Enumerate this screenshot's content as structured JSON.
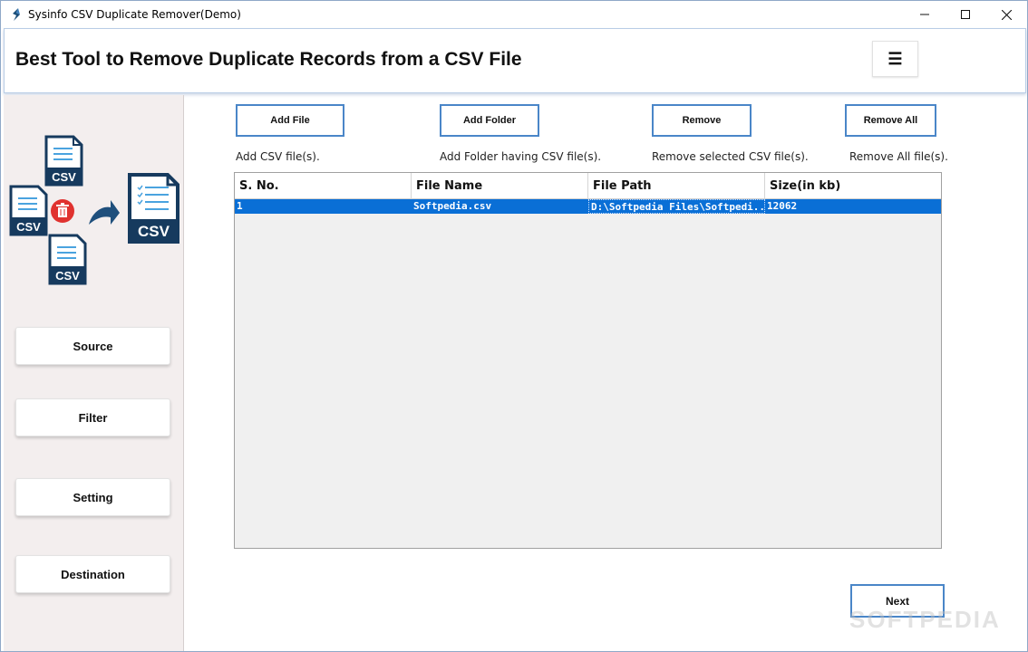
{
  "window": {
    "title": "Sysinfo CSV Duplicate Remover(Demo)"
  },
  "header": {
    "title": "Best Tool to Remove Duplicate Records from a CSV File",
    "menu_icon": "☰"
  },
  "hero": {
    "csv_label": "CSV",
    "icons": [
      "csv-file-icon",
      "delete-icon",
      "arrow-right-icon"
    ]
  },
  "sidebar": {
    "items": [
      {
        "label": "Source"
      },
      {
        "label": "Filter"
      },
      {
        "label": "Setting"
      },
      {
        "label": "Destination"
      }
    ]
  },
  "toolbar": {
    "add_file": {
      "label": "Add File",
      "hint": "Add CSV file(s)."
    },
    "add_folder": {
      "label": "Add Folder",
      "hint": "Add Folder having CSV file(s)."
    },
    "remove": {
      "label": "Remove",
      "hint": "Remove selected CSV file(s)."
    },
    "remove_all": {
      "label": "Remove All",
      "hint": "Remove All file(s)."
    }
  },
  "table": {
    "columns": [
      "S. No.",
      "File Name",
      "File Path",
      "Size(in kb)"
    ],
    "rows": [
      {
        "sno": "1",
        "name": "Softpedia.csv",
        "path": "D:\\Softpedia Files\\Softpedi...",
        "size": "12062"
      }
    ]
  },
  "footer": {
    "next_label": "Next"
  },
  "watermark": "SOFTPEDIA",
  "colors": {
    "accent": "#4a86c8",
    "selection": "#0a6fd6",
    "sidebar_bg": "#f3eeee",
    "doc_navy": "#163a5e",
    "delete_red": "#e0322f"
  }
}
